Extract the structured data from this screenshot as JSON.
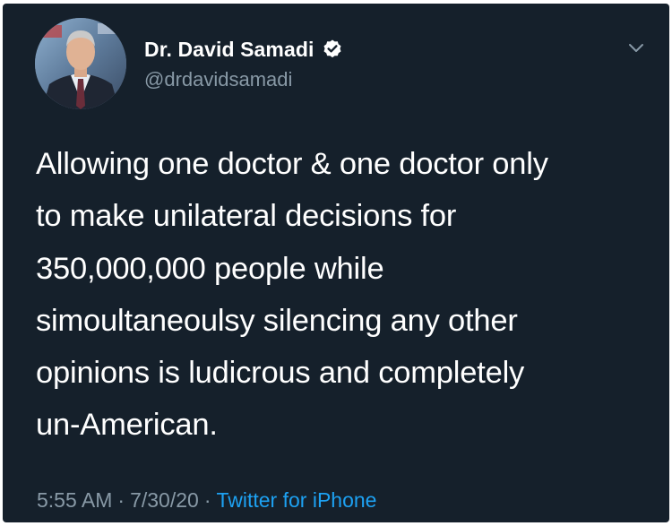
{
  "tweet": {
    "author": {
      "display_name": "Dr. David Samadi",
      "handle": "@drdavidsamadi",
      "verified": true
    },
    "text_lines": [
      "Allowing one doctor & one doctor only",
      "to make unilateral decisions for",
      "350,000,000 people while",
      "simoultaneoulsy silencing any other",
      "opinions is ludicrous and completely",
      "un-American."
    ],
    "time": "5:55 AM",
    "date": "7/30/20",
    "separator": "·",
    "source": "Twitter for iPhone"
  },
  "colors": {
    "background": "#15202b",
    "text": "#ffffff",
    "secondary_text": "#8899a6",
    "link": "#1da1f2",
    "verified_badge": "#ffffff"
  },
  "icons": {
    "verified": "verified-badge-icon",
    "menu": "chevron-down-icon",
    "avatar": "profile-photo"
  }
}
